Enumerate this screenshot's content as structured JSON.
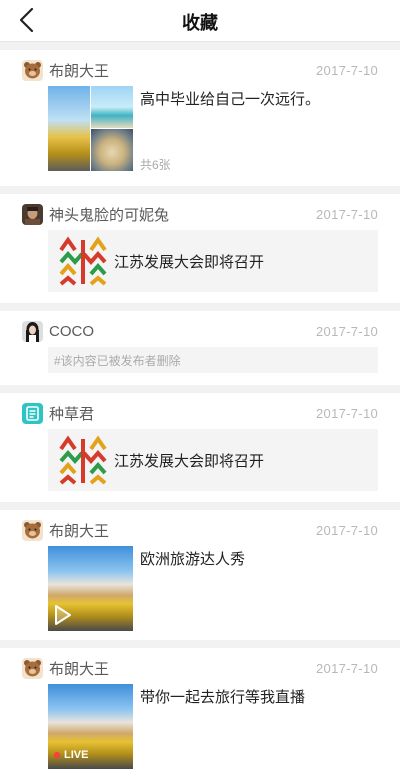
{
  "nav": {
    "title": "收藏",
    "back_icon": "chevron-left-icon"
  },
  "items": [
    {
      "user": "布朗大王",
      "avatar_icon": "bear-avatar",
      "date": "2017-7-10",
      "type": "photos",
      "text": "高中毕业给自己一次远行。",
      "count": "共6张"
    },
    {
      "user": "神头鬼脸的可妮兔",
      "avatar_icon": "photo-avatar",
      "date": "2017-7-10",
      "type": "link",
      "link_text": "江苏发展大会即将召开"
    },
    {
      "user": "COCO",
      "avatar_icon": "girl-avatar",
      "date": "2017-7-10",
      "type": "deleted",
      "notice": "#该内容已被发布者删除"
    },
    {
      "user": "种草君",
      "avatar_icon": "note-avatar",
      "date": "2017-7-10",
      "type": "link",
      "link_text": "江苏发展大会即将召开"
    },
    {
      "user": "布朗大王",
      "avatar_icon": "bear-avatar",
      "date": "2017-7-10",
      "type": "video",
      "text": "欧洲旅游达人秀"
    },
    {
      "user": "布朗大王",
      "avatar_icon": "bear-avatar",
      "date": "2017-7-10",
      "type": "live",
      "text": "带你一起去旅行等我直播",
      "live_label": "LIVE"
    }
  ],
  "colors": {
    "live_dot": "#ff3b3b",
    "note_avatar": "#2ec4c4",
    "bear": "#d8a771"
  }
}
